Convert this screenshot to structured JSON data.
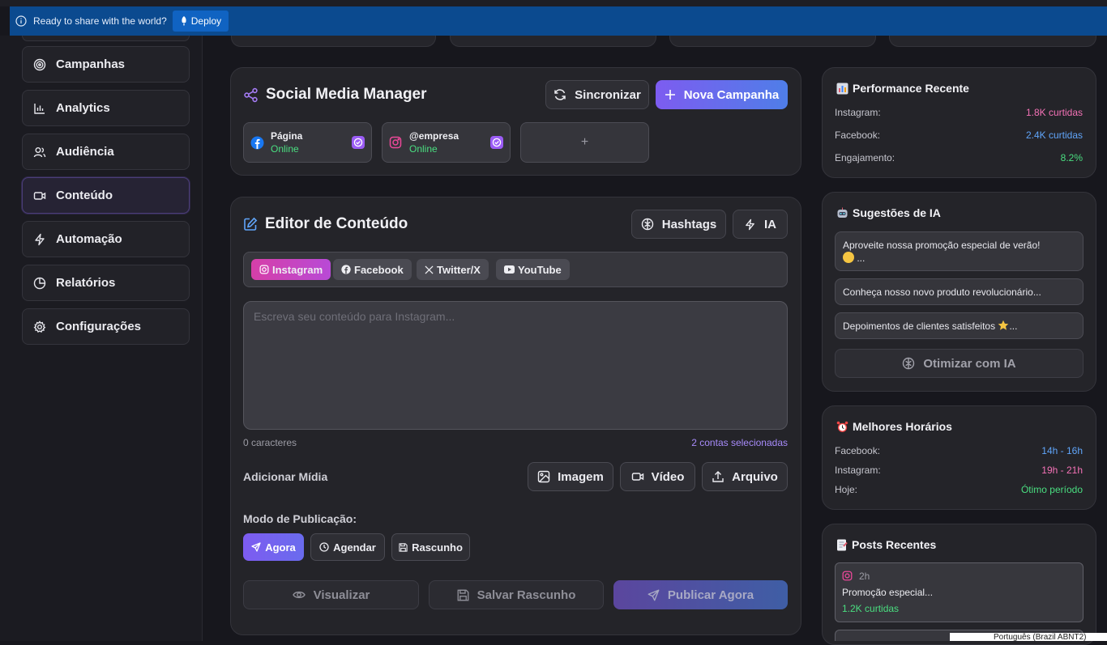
{
  "deploy_bar": {
    "message": "Ready to share with the world?",
    "button": "Deploy"
  },
  "sidebar": {
    "items": [
      {
        "label": "Campanhas",
        "icon": "target-icon"
      },
      {
        "label": "Analytics",
        "icon": "bar-chart-icon"
      },
      {
        "label": "Audiência",
        "icon": "users-icon"
      },
      {
        "label": "Conteúdo",
        "icon": "video-icon",
        "active": true
      },
      {
        "label": "Automação",
        "icon": "lightning-icon"
      },
      {
        "label": "Relatórios",
        "icon": "pie-chart-icon"
      },
      {
        "label": "Configurações",
        "icon": "gear-icon"
      }
    ]
  },
  "social": {
    "title": "Social Media Manager",
    "sync_button": "Sincronizar",
    "new_campaign_button": "Nova Campanha",
    "accounts": [
      {
        "name": "Página",
        "status": "Online",
        "network": "facebook"
      },
      {
        "name": "@empresa",
        "status": "Online",
        "network": "instagram"
      }
    ],
    "add_account_label": "+"
  },
  "editor": {
    "title": "Editor de Conteúdo",
    "hashtags_button": "Hashtags",
    "ai_button": "IA",
    "tabs": [
      "Instagram",
      "Facebook",
      "Twitter/X",
      "YouTube"
    ],
    "active_tab": "Instagram",
    "placeholder": "Escreva seu conteúdo para Instagram...",
    "char_count": "0 caracteres",
    "selected_accounts": "2 contas selecionadas",
    "media_label": "Adicionar Mídia",
    "media_buttons": {
      "image": "Imagem",
      "video": "Vídeo",
      "file": "Arquivo"
    },
    "mode_label": "Modo de Publicação:",
    "modes": {
      "now": "Agora",
      "schedule": "Agendar",
      "draft": "Rascunho"
    },
    "actions": {
      "preview": "Visualizar",
      "save_draft": "Salvar Rascunho",
      "publish": "Publicar Agora"
    }
  },
  "performance": {
    "title": "Performance Recente",
    "rows": [
      {
        "label": "Instagram:",
        "value": "1.8K curtidas",
        "color": "#f472b6"
      },
      {
        "label": "Facebook:",
        "value": "2.4K curtidas",
        "color": "#60a5fa"
      },
      {
        "label": "Engajamento:",
        "value": "8.2%",
        "color": "#4ade80"
      }
    ]
  },
  "suggestions": {
    "title": "Sugestões de IA",
    "items": [
      {
        "text": "Aproveite nossa promoção especial de verão!",
        "tail": "..."
      },
      {
        "text": "Conheça nosso novo produto revolucionário...",
        "tail": ""
      },
      {
        "text": "Depoimentos de clientes satisfeitos",
        "tail": "..."
      }
    ],
    "optimize_button": "Otimizar com IA"
  },
  "best_times": {
    "title": "Melhores Horários",
    "rows": [
      {
        "label": "Facebook:",
        "value": "14h - 16h",
        "color": "#60a5fa"
      },
      {
        "label": "Instagram:",
        "value": "19h - 21h",
        "color": "#f472b6"
      },
      {
        "label": "Hoje:",
        "value": "Ótimo período",
        "color": "#4ade80"
      }
    ]
  },
  "recent_posts": {
    "title": "Posts Recentes",
    "items": [
      {
        "time": "2h",
        "text": "Promoção especial...",
        "stats": "1.2K curtidas",
        "network": "instagram"
      }
    ]
  },
  "taskbar": {
    "language": "Português (Brazil ABNT2)"
  },
  "colors": {
    "accent": "#7d5cf0",
    "accent2": "#4f7ee8",
    "online": "#4ade80",
    "instagram": "#e1306c",
    "facebook": "#1877f2"
  }
}
